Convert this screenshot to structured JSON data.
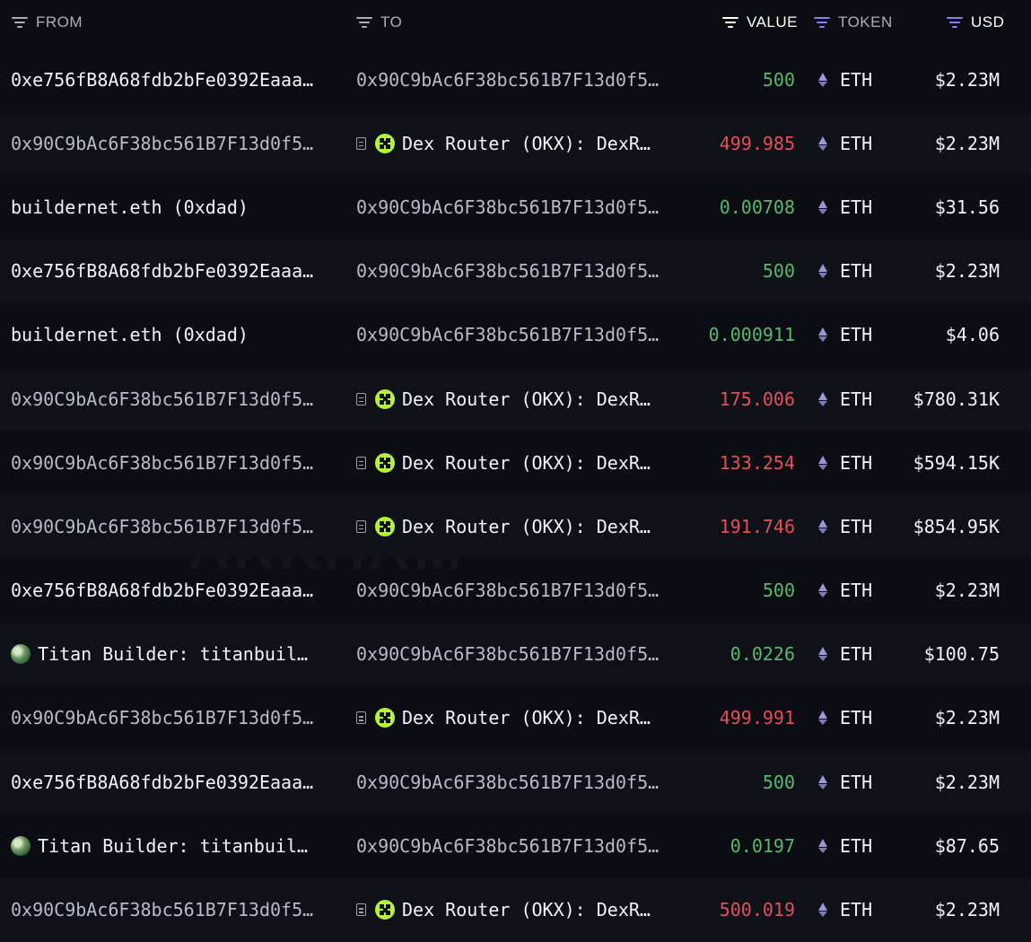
{
  "header": {
    "from": "FROM",
    "to": "TO",
    "value": "VALUE",
    "token": "TOKEN",
    "usd": "USD"
  },
  "watermark": "ARKHAM",
  "colors": {
    "positive": "#58b96a",
    "negative": "#e4505a",
    "okx": "#b5f23a",
    "filter_accent": "#8d7cf0"
  },
  "rows": [
    {
      "from": "0xe756fB8A68fdb2bFe0392Eaaa…",
      "from_style": "bright",
      "from_icon": "",
      "to": "0x90C9bAc6F38bc561B7F13d0f5…",
      "to_style": "dim",
      "to_icon": "",
      "value": "500",
      "value_color": "green",
      "token": "ETH",
      "usd": "$2.23M"
    },
    {
      "from": "0x90C9bAc6F38bc561B7F13d0f5…",
      "from_style": "dim",
      "from_icon": "",
      "to": "Dex Router (OKX): DexR…",
      "to_style": "bright",
      "to_icon": "okx",
      "value": "499.985",
      "value_color": "red",
      "token": "ETH",
      "usd": "$2.23M"
    },
    {
      "from": "buildernet.eth (0xdad)",
      "from_style": "bright",
      "from_icon": "",
      "to": "0x90C9bAc6F38bc561B7F13d0f5…",
      "to_style": "dim",
      "to_icon": "",
      "value": "0.00708",
      "value_color": "green",
      "token": "ETH",
      "usd": "$31.56"
    },
    {
      "from": "0xe756fB8A68fdb2bFe0392Eaaa…",
      "from_style": "bright",
      "from_icon": "",
      "to": "0x90C9bAc6F38bc561B7F13d0f5…",
      "to_style": "dim",
      "to_icon": "",
      "value": "500",
      "value_color": "green",
      "token": "ETH",
      "usd": "$2.23M"
    },
    {
      "from": "buildernet.eth (0xdad)",
      "from_style": "bright",
      "from_icon": "",
      "to": "0x90C9bAc6F38bc561B7F13d0f5…",
      "to_style": "dim",
      "to_icon": "",
      "value": "0.000911",
      "value_color": "green",
      "token": "ETH",
      "usd": "$4.06"
    },
    {
      "from": "0x90C9bAc6F38bc561B7F13d0f5…",
      "from_style": "dim",
      "from_icon": "",
      "to": "Dex Router (OKX): DexR…",
      "to_style": "bright",
      "to_icon": "okx",
      "value": "175.006",
      "value_color": "red",
      "token": "ETH",
      "usd": "$780.31K"
    },
    {
      "from": "0x90C9bAc6F38bc561B7F13d0f5…",
      "from_style": "dim",
      "from_icon": "",
      "to": "Dex Router (OKX): DexR…",
      "to_style": "bright",
      "to_icon": "okx",
      "value": "133.254",
      "value_color": "red",
      "token": "ETH",
      "usd": "$594.15K"
    },
    {
      "from": "0x90C9bAc6F38bc561B7F13d0f5…",
      "from_style": "dim",
      "from_icon": "",
      "to": "Dex Router (OKX): DexR…",
      "to_style": "bright",
      "to_icon": "okx",
      "value": "191.746",
      "value_color": "red",
      "token": "ETH",
      "usd": "$854.95K"
    },
    {
      "from": "0xe756fB8A68fdb2bFe0392Eaaa…",
      "from_style": "bright",
      "from_icon": "",
      "to": "0x90C9bAc6F38bc561B7F13d0f5…",
      "to_style": "dim",
      "to_icon": "",
      "value": "500",
      "value_color": "green",
      "token": "ETH",
      "usd": "$2.23M"
    },
    {
      "from": "Titan Builder: titanbuil…",
      "from_style": "bright",
      "from_icon": "globe",
      "to": "0x90C9bAc6F38bc561B7F13d0f5…",
      "to_style": "dim",
      "to_icon": "",
      "value": "0.0226",
      "value_color": "green",
      "token": "ETH",
      "usd": "$100.75"
    },
    {
      "from": "0x90C9bAc6F38bc561B7F13d0f5…",
      "from_style": "dim",
      "from_icon": "",
      "to": "Dex Router (OKX): DexR…",
      "to_style": "bright",
      "to_icon": "okx",
      "value": "499.991",
      "value_color": "red",
      "token": "ETH",
      "usd": "$2.23M"
    },
    {
      "from": "0xe756fB8A68fdb2bFe0392Eaaa…",
      "from_style": "bright",
      "from_icon": "",
      "to": "0x90C9bAc6F38bc561B7F13d0f5…",
      "to_style": "dim",
      "to_icon": "",
      "value": "500",
      "value_color": "green",
      "token": "ETH",
      "usd": "$2.23M"
    },
    {
      "from": "Titan Builder: titanbuil…",
      "from_style": "bright",
      "from_icon": "globe",
      "to": "0x90C9bAc6F38bc561B7F13d0f5…",
      "to_style": "dim",
      "to_icon": "",
      "value": "0.0197",
      "value_color": "green",
      "token": "ETH",
      "usd": "$87.65"
    },
    {
      "from": "0x90C9bAc6F38bc561B7F13d0f5…",
      "from_style": "dim",
      "from_icon": "",
      "to": "Dex Router (OKX): DexR…",
      "to_style": "bright",
      "to_icon": "okx",
      "value": "500.019",
      "value_color": "red",
      "token": "ETH",
      "usd": "$2.23M"
    }
  ]
}
